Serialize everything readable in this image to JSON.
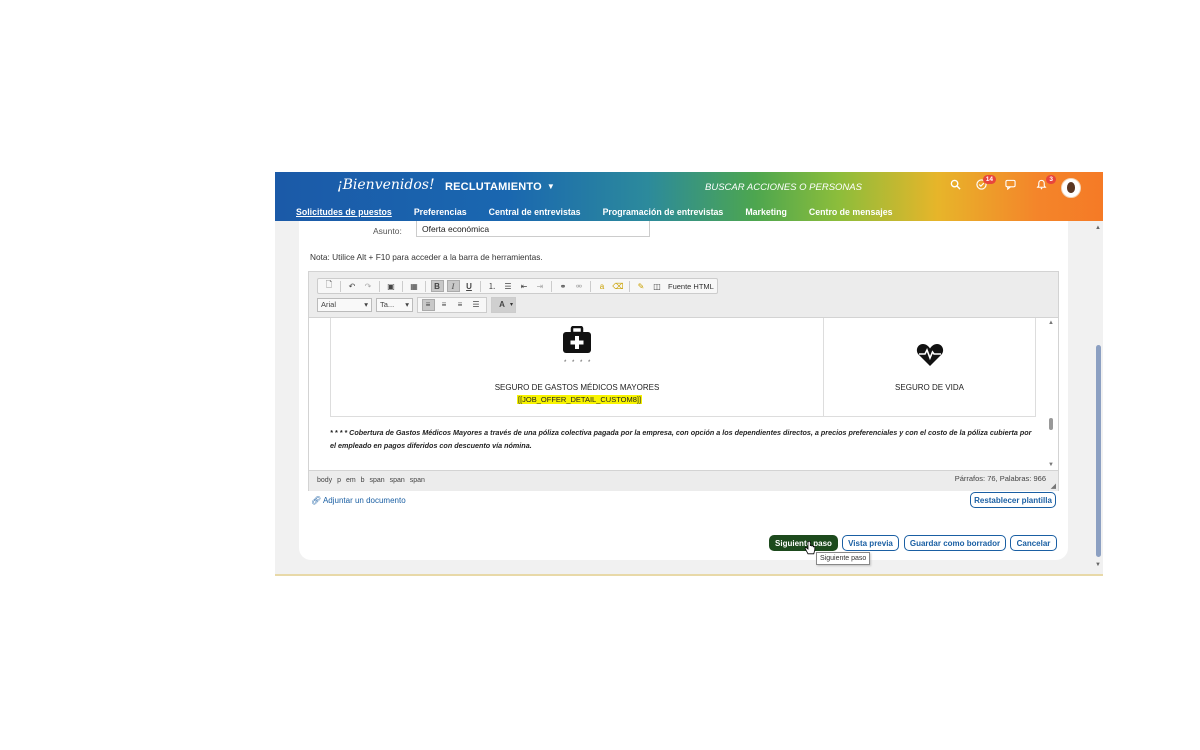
{
  "header": {
    "logo_text": "¡Bienvenidos!",
    "module": "RECLUTAMIENTO",
    "search_label": "BUSCAR ACCIONES O PERSONAS",
    "todo_badge": "14",
    "notif_badge": "3",
    "icons": [
      "search-icon",
      "todo-icon",
      "chat-icon",
      "bell-icon",
      "avatar"
    ]
  },
  "nav": {
    "items": [
      "Solicitudes de puestos",
      "Preferencias",
      "Central de entrevistas",
      "Programación de entrevistas",
      "Marketing",
      "Centro de mensajes"
    ],
    "active": "Solicitudes de puestos"
  },
  "form": {
    "subject_label": "Asunto:",
    "subject_value": "Oferta económica",
    "note": "Nota: Utilice Alt + F10 para acceder a la barra de herramientas."
  },
  "toolbar": {
    "html_source": "Fuente HTML",
    "font_name": "Arial",
    "font_size": "Ta...",
    "color_label": "A"
  },
  "editor": {
    "stars": "* * * *",
    "medical_title": "SEGURO DE GASTOS MÉDICOS MAYORES",
    "medical_code": "[[JOB_OFFER_DETAIL_CUSTOM8]]",
    "life_title": "SEGURO DE VIDA",
    "fineprint": "* * * * Cobertura de Gastos Médicos Mayores a través de una póliza colectiva pagada por la empresa, con opción a los dependientes directos, a precios preferenciales y con el costo de la póliza cubierta por el empleado en pagos diferidos con descuento vía nómina.",
    "path": "body p em b span span span",
    "word_count": "Párrafos: 76, Palabras: 966"
  },
  "actions": {
    "attach": "Adjuntar un documento",
    "restore": "Restablecer plantilla",
    "next": "Siguiente paso",
    "preview": "Vista previa",
    "save_draft": "Guardar como borrador",
    "cancel": "Cancelar",
    "tooltip": "Siguiente paso"
  },
  "colors": {
    "primary": "#1a5fa3",
    "next_button": "#1d4a1d",
    "highlight": "#f8f400"
  }
}
